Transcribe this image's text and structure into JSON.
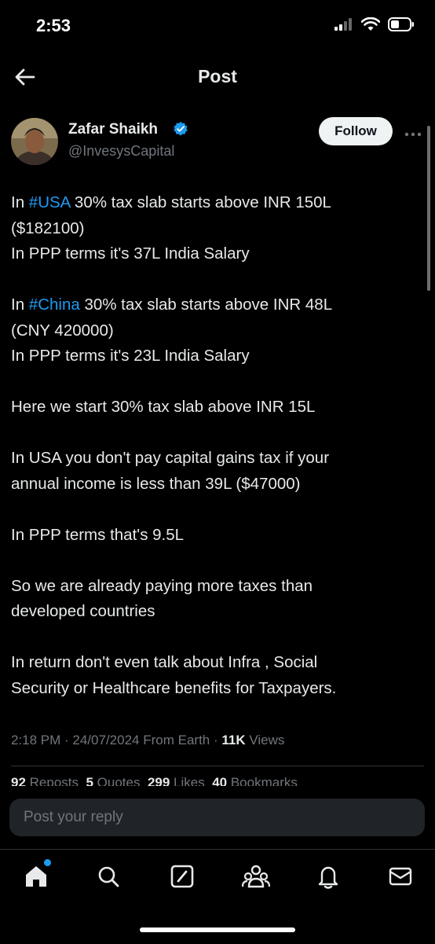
{
  "status_bar": {
    "time": "2:53"
  },
  "header": {
    "title": "Post"
  },
  "post": {
    "author_name": "Zafar Shaikh",
    "handle": "@InvesysCapital",
    "follow_label": "Follow",
    "paragraphs": {
      "p1": {
        "l1_pre": "In ",
        "l1_tag": "#USA",
        "l1_post": " 30% tax slab starts above INR 150L",
        "l2": "($182100)",
        "l3": "In PPP terms it's 37L India Salary"
      },
      "p2": {
        "l1_pre": "In ",
        "l1_tag": "#China",
        "l1_post": " 30% tax slab starts above INR 48L",
        "l2": "(CNY 420000)",
        "l3": "In PPP terms it's 23L India Salary"
      },
      "p3": "Here we start 30% tax slab above INR 15L",
      "p4": {
        "l1": "In USA you don't pay capital gains tax if your",
        "l2": "annual income is less than 39L ($47000)"
      },
      "p5": "In PPP terms that's 9.5L",
      "p6": {
        "l1": "So we are already paying more taxes than",
        "l2": "developed countries"
      },
      "p7": {
        "l1": "In return don't even talk about Infra , Social",
        "l2": "Security or Healthcare benefits for Taxpayers."
      }
    },
    "meta": {
      "time": "2:18 PM",
      "sep1": " · ",
      "date": "24/07/2024",
      "source": " From Earth",
      "sep2": " · ",
      "views_count": "11K",
      "views_label": " Views"
    },
    "stats": {
      "reposts_count": "92",
      "reposts_label": " Reposts",
      "quotes_count": "5",
      "quotes_label": " Quotes",
      "likes_count": "299",
      "likes_label": " Likes",
      "bookmarks_count": "40",
      "bookmarks_label": " Bookmarks"
    }
  },
  "reply": {
    "placeholder": "Post your reply"
  },
  "icons": {
    "back": "arrow-left-icon",
    "verified": "verified-badge-icon",
    "more": "more-dots-icon",
    "home": "home-icon",
    "search": "search-icon",
    "grok": "grok-icon",
    "communities": "communities-icon",
    "notifications": "bell-icon",
    "messages": "mail-icon"
  },
  "colors": {
    "accent": "#1d9bf0",
    "background": "#000000",
    "text": "#e7e9ea",
    "secondary": "#71767b"
  }
}
